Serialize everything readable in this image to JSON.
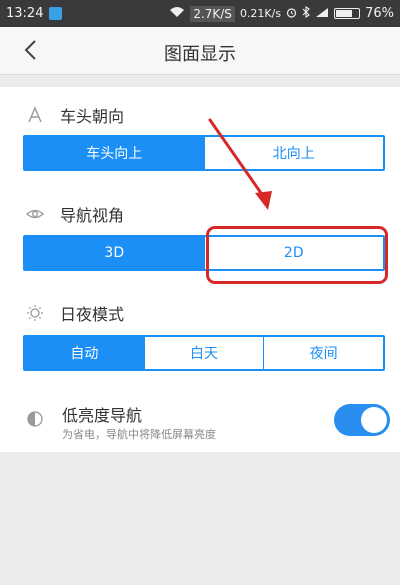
{
  "status_bar": {
    "time": "13:24",
    "net_speed": "2.7K/S",
    "net_speed2": "0.21K/s",
    "battery": "76%",
    "battery_level": 0.76
  },
  "header": {
    "title": "图面显示"
  },
  "sections": {
    "heading": {
      "label": "车头朝向",
      "options": [
        "车头向上",
        "北向上"
      ],
      "selected": 0
    },
    "view": {
      "label": "导航视角",
      "options": [
        "3D",
        "2D"
      ],
      "selected": 0
    },
    "daynight": {
      "label": "日夜模式",
      "options": [
        "自动",
        "白天",
        "夜间"
      ],
      "selected": 0
    }
  },
  "low_brightness": {
    "title": "低亮度导航",
    "subtitle": "为省电，导航中将降低屏幕亮度",
    "enabled": true
  },
  "colors": {
    "accent": "#1b8ff5",
    "annotation": "#d72828"
  }
}
